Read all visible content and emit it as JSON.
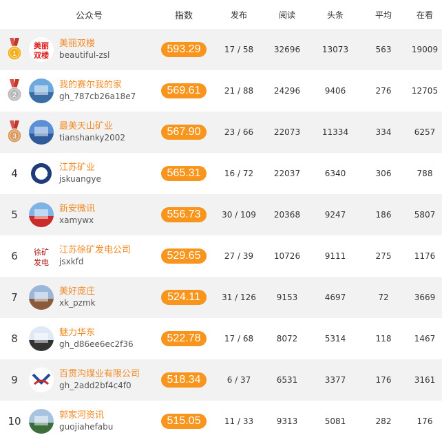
{
  "headers": {
    "account": "公众号",
    "index": "指数",
    "publish": "发布",
    "read": "阅读",
    "headline": "头条",
    "average": "平均",
    "watching": "在看"
  },
  "medal_colors": [
    "#f2b01e",
    "#b8b8b8",
    "#d89a5e"
  ],
  "accent_color": "#f7951d",
  "rows": [
    {
      "rank": "1",
      "name": "美丽双楼",
      "id": "beautiful-zsl",
      "score": "593.29",
      "publish": "17 / 58",
      "read": "32696",
      "headline": "13073",
      "average": "563",
      "watching": "19009",
      "avatar_text": "美丽\n双楼"
    },
    {
      "rank": "2",
      "name": "我的赛尔我的家",
      "id": "gh_787cb26a18e7",
      "score": "569.61",
      "publish": "21 / 88",
      "read": "24296",
      "headline": "9406",
      "average": "276",
      "watching": "12705",
      "avatar_text": ""
    },
    {
      "rank": "3",
      "name": "最美天山矿业",
      "id": "tianshanky2002",
      "score": "567.90",
      "publish": "23 / 66",
      "read": "22073",
      "headline": "11334",
      "average": "334",
      "watching": "6257",
      "avatar_text": ""
    },
    {
      "rank": "4",
      "name": "江苏矿业",
      "id": "jskuangye",
      "score": "565.31",
      "publish": "16 / 72",
      "read": "22037",
      "headline": "6340",
      "average": "306",
      "watching": "788",
      "avatar_text": "JSME"
    },
    {
      "rank": "5",
      "name": "新安微讯",
      "id": "xamywx",
      "score": "556.73",
      "publish": "30 / 109",
      "read": "20368",
      "headline": "9247",
      "average": "186",
      "watching": "5807",
      "avatar_text": "新安微讯"
    },
    {
      "rank": "6",
      "name": "江苏徐矿发电公司",
      "id": "jsxkfd",
      "score": "529.65",
      "publish": "27 / 39",
      "read": "10726",
      "headline": "9111",
      "average": "275",
      "watching": "1176",
      "avatar_text": "徐矿\n发电"
    },
    {
      "rank": "7",
      "name": "美好庞庄",
      "id": "xk_pzmk",
      "score": "524.11",
      "publish": "31 / 126",
      "read": "9153",
      "headline": "4697",
      "average": "72",
      "watching": "3669",
      "avatar_text": ""
    },
    {
      "rank": "8",
      "name": "魅力华东",
      "id": "gh_d86ee6ec2f36",
      "score": "522.78",
      "publish": "17 / 68",
      "read": "8072",
      "headline": "5314",
      "average": "118",
      "watching": "1467",
      "avatar_text": "魅力华东"
    },
    {
      "rank": "9",
      "name": "百贯沟煤业有限公司",
      "id": "gh_2add2bf4c4f0",
      "score": "518.34",
      "publish": "6 / 37",
      "read": "6531",
      "headline": "3377",
      "average": "176",
      "watching": "3161",
      "avatar_text": "百贯集团"
    },
    {
      "rank": "10",
      "name": "郭家河资讯",
      "id": "guojiahefabu",
      "score": "515.05",
      "publish": "11 / 33",
      "read": "9313",
      "headline": "5081",
      "average": "282",
      "watching": "176",
      "avatar_text": "郭家河资讯"
    }
  ]
}
